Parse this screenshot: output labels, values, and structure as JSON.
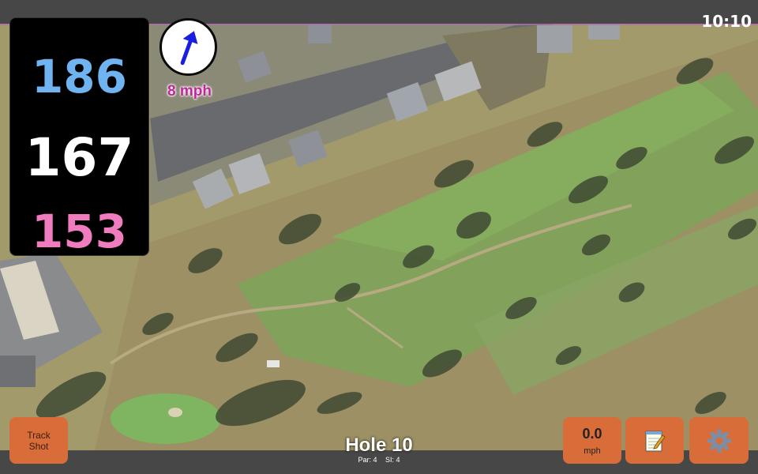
{
  "status": {
    "time": "10:10"
  },
  "distances": {
    "back": "186",
    "middle": "167",
    "front": "153"
  },
  "wind": {
    "speed_label": "8 mph",
    "direction_deg": 20
  },
  "hole": {
    "title": "Hole 10",
    "par_label": "Par: 4",
    "si_label": "SI: 4"
  },
  "buttons": {
    "track_shot_line1": "Track",
    "track_shot_line2": "Shot",
    "speed_value": "0.0",
    "speed_unit": "mph",
    "notes_icon": "notepad-icon",
    "settings_icon": "gear-icon"
  },
  "colors": {
    "back": "#6fb3f0",
    "middle": "#ffffff",
    "front": "#f07cc0",
    "button": "#d96d3a",
    "wind_text": "#c0279b"
  }
}
